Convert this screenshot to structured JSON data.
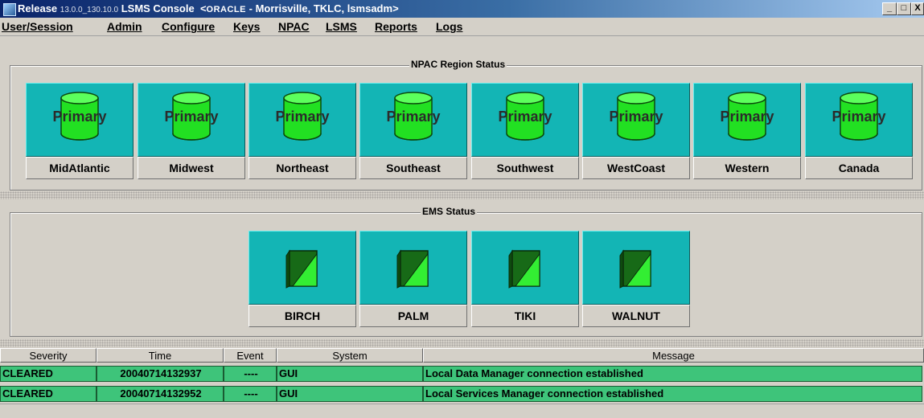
{
  "window": {
    "title_prefix": "Release",
    "title_version": "13.0.0_130.10.0",
    "title_app": "LSMS Console",
    "title_brand": "ORACLE",
    "title_location": "- Morrisville, TKLC, lsmsadm",
    "minimize_label": "_",
    "maximize_label": "□",
    "close_label": "X"
  },
  "menu": {
    "items": [
      {
        "label": "User/Session"
      },
      {
        "label": "Admin"
      },
      {
        "label": "Configure"
      },
      {
        "label": "Keys"
      },
      {
        "label": "NPAC"
      },
      {
        "label": "LSMS"
      },
      {
        "label": "Reports"
      },
      {
        "label": "Logs"
      }
    ]
  },
  "npac_panel": {
    "title": "NPAC Region Status",
    "regions": [
      {
        "status": "Primary",
        "name": "MidAtlantic"
      },
      {
        "status": "Primary",
        "name": "Midwest"
      },
      {
        "status": "Primary",
        "name": "Northeast"
      },
      {
        "status": "Primary",
        "name": "Southeast"
      },
      {
        "status": "Primary",
        "name": "Southwest"
      },
      {
        "status": "Primary",
        "name": "WestCoast"
      },
      {
        "status": "Primary",
        "name": "Western"
      },
      {
        "status": "Primary",
        "name": "Canada"
      }
    ]
  },
  "ems_panel": {
    "title": "EMS Status",
    "systems": [
      {
        "name": "BIRCH"
      },
      {
        "name": "PALM"
      },
      {
        "name": "TIKI"
      },
      {
        "name": "WALNUT"
      }
    ]
  },
  "event_table": {
    "columns": [
      "Severity",
      "Time",
      "Event",
      "System",
      "Message"
    ],
    "rows": [
      {
        "severity": "CLEARED",
        "time": "20040714132937",
        "event": "----",
        "system": "GUI",
        "message": "Local Data Manager connection established"
      },
      {
        "severity": "CLEARED",
        "time": "20040714132952",
        "event": "----",
        "system": "GUI",
        "message": "Local Services Manager connection established"
      }
    ]
  },
  "colors": {
    "tile": "#13b5b5",
    "db": "#22e022",
    "row_cleared": "#3ec47a",
    "titlebar": "#0a246a"
  },
  "icons": {
    "region": "database-cylinder-icon",
    "ems": "server-box-icon"
  }
}
